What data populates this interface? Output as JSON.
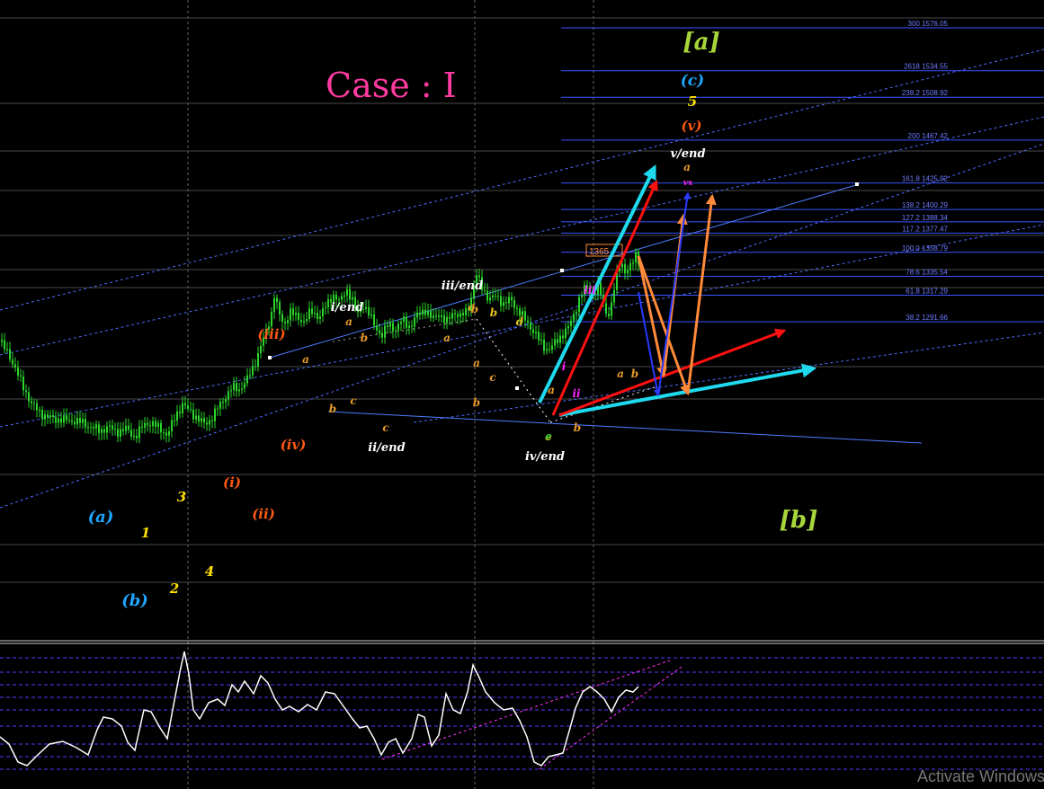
{
  "chart_data": {
    "type": "line",
    "title": "Case : I",
    "xlabel": "",
    "ylabel": "",
    "ylim": [
      1170,
      1600
    ],
    "price_tag": "1365",
    "fib_levels": [
      {
        "pct": "300",
        "price": 1576.05
      },
      {
        "pct": "2618",
        "price": 1534.55
      },
      {
        "pct": "238.2",
        "price": 1508.92
      },
      {
        "pct": "200",
        "price": 1467.42
      },
      {
        "pct": "161.8",
        "price": 1425.92
      },
      {
        "pct": "138.2",
        "price": 1400.29
      },
      {
        "pct": "127.2",
        "price": 1388.34
      },
      {
        "pct": "117.2",
        "price": 1377.47
      },
      {
        "pct": "100.0",
        "price": 1358.79
      },
      {
        "pct": "78.6",
        "price": 1335.54
      },
      {
        "pct": "61.8",
        "price": 1317.29
      },
      {
        "pct": "38.2",
        "price": 1291.66
      }
    ],
    "price_path": [
      [
        0,
        1272
      ],
      [
        10,
        1260
      ],
      [
        22,
        1236
      ],
      [
        35,
        1212
      ],
      [
        50,
        1200
      ],
      [
        65,
        1197
      ],
      [
        80,
        1196
      ],
      [
        92,
        1194
      ],
      [
        100,
        1190
      ],
      [
        112,
        1186
      ],
      [
        120,
        1190
      ],
      [
        130,
        1185
      ],
      [
        140,
        1188
      ],
      [
        150,
        1180
      ],
      [
        160,
        1192
      ],
      [
        168,
        1194
      ],
      [
        178,
        1188
      ],
      [
        186,
        1182
      ],
      [
        195,
        1200
      ],
      [
        203,
        1212
      ],
      [
        212,
        1204
      ],
      [
        220,
        1198
      ],
      [
        228,
        1192
      ],
      [
        235,
        1198
      ],
      [
        242,
        1208
      ],
      [
        250,
        1218
      ],
      [
        258,
        1228
      ],
      [
        266,
        1226
      ],
      [
        275,
        1236
      ],
      [
        282,
        1248
      ],
      [
        290,
        1268
      ],
      [
        296,
        1282
      ],
      [
        302,
        1300
      ],
      [
        305,
        1318
      ],
      [
        310,
        1300
      ],
      [
        316,
        1288
      ],
      [
        322,
        1302
      ],
      [
        330,
        1296
      ],
      [
        338,
        1292
      ],
      [
        346,
        1302
      ],
      [
        355,
        1296
      ],
      [
        362,
        1306
      ],
      [
        370,
        1318
      ],
      [
        378,
        1310
      ],
      [
        385,
        1324
      ],
      [
        392,
        1312
      ],
      [
        398,
        1300
      ],
      [
        404,
        1308
      ],
      [
        412,
        1296
      ],
      [
        418,
        1286
      ],
      [
        425,
        1278
      ],
      [
        432,
        1290
      ],
      [
        440,
        1284
      ],
      [
        448,
        1294
      ],
      [
        456,
        1286
      ],
      [
        464,
        1298
      ],
      [
        472,
        1304
      ],
      [
        480,
        1294
      ],
      [
        488,
        1300
      ],
      [
        496,
        1290
      ],
      [
        504,
        1302
      ],
      [
        512,
        1296
      ],
      [
        520,
        1304
      ],
      [
        525,
        1318
      ],
      [
        530,
        1336
      ],
      [
        536,
        1326
      ],
      [
        544,
        1312
      ],
      [
        552,
        1318
      ],
      [
        560,
        1308
      ],
      [
        568,
        1314
      ],
      [
        576,
        1302
      ],
      [
        584,
        1294
      ],
      [
        592,
        1284
      ],
      [
        598,
        1276
      ],
      [
        604,
        1268
      ],
      [
        610,
        1264
      ],
      [
        616,
        1270
      ],
      [
        624,
        1278
      ],
      [
        632,
        1286
      ],
      [
        638,
        1298
      ],
      [
        645,
        1316
      ],
      [
        652,
        1326
      ],
      [
        660,
        1318
      ],
      [
        666,
        1326
      ],
      [
        672,
        1304
      ],
      [
        678,
        1298
      ],
      [
        684,
        1328
      ],
      [
        690,
        1352
      ],
      [
        696,
        1338
      ],
      [
        702,
        1346
      ],
      [
        708,
        1360
      ],
      [
        712,
        1344
      ]
    ],
    "osc_path": [
      [
        0,
        820
      ],
      [
        10,
        828
      ],
      [
        20,
        848
      ],
      [
        30,
        852
      ],
      [
        42,
        840
      ],
      [
        55,
        828
      ],
      [
        70,
        825
      ],
      [
        85,
        832
      ],
      [
        98,
        840
      ],
      [
        108,
        812
      ],
      [
        115,
        798
      ],
      [
        125,
        800
      ],
      [
        135,
        808
      ],
      [
        142,
        826
      ],
      [
        150,
        835
      ],
      [
        160,
        790
      ],
      [
        168,
        792
      ],
      [
        178,
        810
      ],
      [
        186,
        822
      ],
      [
        192,
        790
      ],
      [
        200,
        748
      ],
      [
        205,
        725
      ],
      [
        210,
        750
      ],
      [
        215,
        790
      ],
      [
        222,
        800
      ],
      [
        232,
        782
      ],
      [
        242,
        778
      ],
      [
        250,
        785
      ],
      [
        258,
        762
      ],
      [
        265,
        770
      ],
      [
        272,
        758
      ],
      [
        282,
        772
      ],
      [
        290,
        752
      ],
      [
        298,
        760
      ],
      [
        306,
        778
      ],
      [
        314,
        790
      ],
      [
        322,
        786
      ],
      [
        332,
        792
      ],
      [
        342,
        784
      ],
      [
        352,
        790
      ],
      [
        362,
        770
      ],
      [
        372,
        772
      ],
      [
        382,
        786
      ],
      [
        392,
        800
      ],
      [
        400,
        810
      ],
      [
        408,
        808
      ],
      [
        416,
        822
      ],
      [
        424,
        840
      ],
      [
        432,
        826
      ],
      [
        440,
        822
      ],
      [
        448,
        838
      ],
      [
        458,
        822
      ],
      [
        465,
        795
      ],
      [
        472,
        798
      ],
      [
        480,
        830
      ],
      [
        488,
        818
      ],
      [
        496,
        772
      ],
      [
        504,
        790
      ],
      [
        512,
        794
      ],
      [
        520,
        770
      ],
      [
        526,
        740
      ],
      [
        532,
        752
      ],
      [
        540,
        770
      ],
      [
        550,
        782
      ],
      [
        560,
        790
      ],
      [
        570,
        788
      ],
      [
        578,
        802
      ],
      [
        586,
        820
      ],
      [
        594,
        848
      ],
      [
        602,
        852
      ],
      [
        610,
        842
      ],
      [
        618,
        840
      ],
      [
        626,
        838
      ],
      [
        634,
        810
      ],
      [
        640,
        788
      ],
      [
        648,
        770
      ],
      [
        656,
        764
      ],
      [
        664,
        770
      ],
      [
        672,
        778
      ],
      [
        680,
        792
      ],
      [
        688,
        776
      ],
      [
        696,
        768
      ],
      [
        704,
        770
      ],
      [
        710,
        764
      ]
    ],
    "wave_labels": [
      {
        "text": "(a)",
        "color": "#1ea6ff",
        "size": 18
      },
      {
        "text": "(b)",
        "color": "#1ea6ff",
        "size": 18
      },
      {
        "text": "1",
        "color": "#ffe100",
        "size": 15
      },
      {
        "text": "2",
        "color": "#ffe100",
        "size": 15
      },
      {
        "text": "3",
        "color": "#ffe100",
        "size": 15
      },
      {
        "text": "4",
        "color": "#ffe100",
        "size": 15
      },
      {
        "text": "(i)",
        "color": "#ff5a12",
        "size": 15
      },
      {
        "text": "(ii)",
        "color": "#ff5a12",
        "size": 15
      },
      {
        "text": "(iii)",
        "color": "#ff5a12",
        "size": 15
      },
      {
        "text": "(iv)",
        "color": "#ff5a12",
        "size": 15
      },
      {
        "text": "i/end",
        "color": "#ffffff",
        "size": 13
      },
      {
        "text": "ii/end",
        "color": "#ffffff",
        "size": 13
      },
      {
        "text": "iii/end",
        "color": "#ffffff",
        "size": 13
      },
      {
        "text": "iv/end",
        "color": "#ffffff",
        "size": 13
      },
      {
        "text": "v/end",
        "color": "#ffffff",
        "size": 13
      },
      {
        "text": "[a]",
        "color": "#a6d63a",
        "size": 26
      },
      {
        "text": "[b]",
        "color": "#a6d63a",
        "size": 26
      },
      {
        "text": "(c)",
        "color": "#1ea6ff",
        "size": 17
      },
      {
        "text": "5",
        "color": "#ffe100",
        "size": 15
      },
      {
        "text": "(v)",
        "color": "#ff5a12",
        "size": 15
      },
      {
        "text": "a",
        "color": "#e89a2a",
        "size": 12
      },
      {
        "text": "b",
        "color": "#e89a2a",
        "size": 12
      },
      {
        "text": "c",
        "color": "#e89a2a",
        "size": 12
      },
      {
        "text": "a",
        "color": "#e89a2a",
        "size": 12
      },
      {
        "text": "b",
        "color": "#e89a2a",
        "size": 12
      },
      {
        "text": "c",
        "color": "#e89a2a",
        "size": 12
      },
      {
        "text": "a",
        "color": "#e89a2a",
        "size": 12
      },
      {
        "text": "b",
        "color": "#e89a2a",
        "size": 12
      },
      {
        "text": "c",
        "color": "#e89a2a",
        "size": 12
      },
      {
        "text": "a",
        "color": "#e89a2a",
        "size": 12
      },
      {
        "text": "b",
        "color": "#e89a2a",
        "size": 12
      },
      {
        "text": "c",
        "color": "#e89a2a",
        "size": 12
      },
      {
        "text": "d",
        "color": "#e8c21a",
        "size": 12
      },
      {
        "text": "e",
        "color": "#e8c21a",
        "size": 12
      },
      {
        "text": "b",
        "color": "#e8c21a",
        "size": 12
      },
      {
        "text": "a",
        "color": "#e89a2a",
        "size": 12
      },
      {
        "text": "b",
        "color": "#e89a2a",
        "size": 12
      },
      {
        "text": "a",
        "color": "#e89a2a",
        "size": 12
      },
      {
        "text": "b",
        "color": "#e89a2a",
        "size": 12
      },
      {
        "text": "i",
        "color": "#ff22ff",
        "size": 12
      },
      {
        "text": "ii",
        "color": "#ff22ff",
        "size": 12
      },
      {
        "text": "iii",
        "color": "#ff22ff",
        "size": 12
      },
      {
        "text": "vx",
        "color": "#ff22ff",
        "size": 9
      },
      {
        "text": "e",
        "color": "#33cc33",
        "size": 11
      },
      {
        "text": "a",
        "color": "#e89a2a",
        "size": 12
      }
    ]
  },
  "colors": {
    "candle": "#2bd62b",
    "fib_line": "#3a55ff",
    "grid": "#666666",
    "arrow_cyan": "#1fd9ee",
    "arrow_red": "#ff1010",
    "arrow_orange": "#ff8a3a",
    "title": "#ff3aa0",
    "oscillator": "#ffffff",
    "osc_level": "#5a3aff"
  },
  "watermark": "Activate Windows"
}
